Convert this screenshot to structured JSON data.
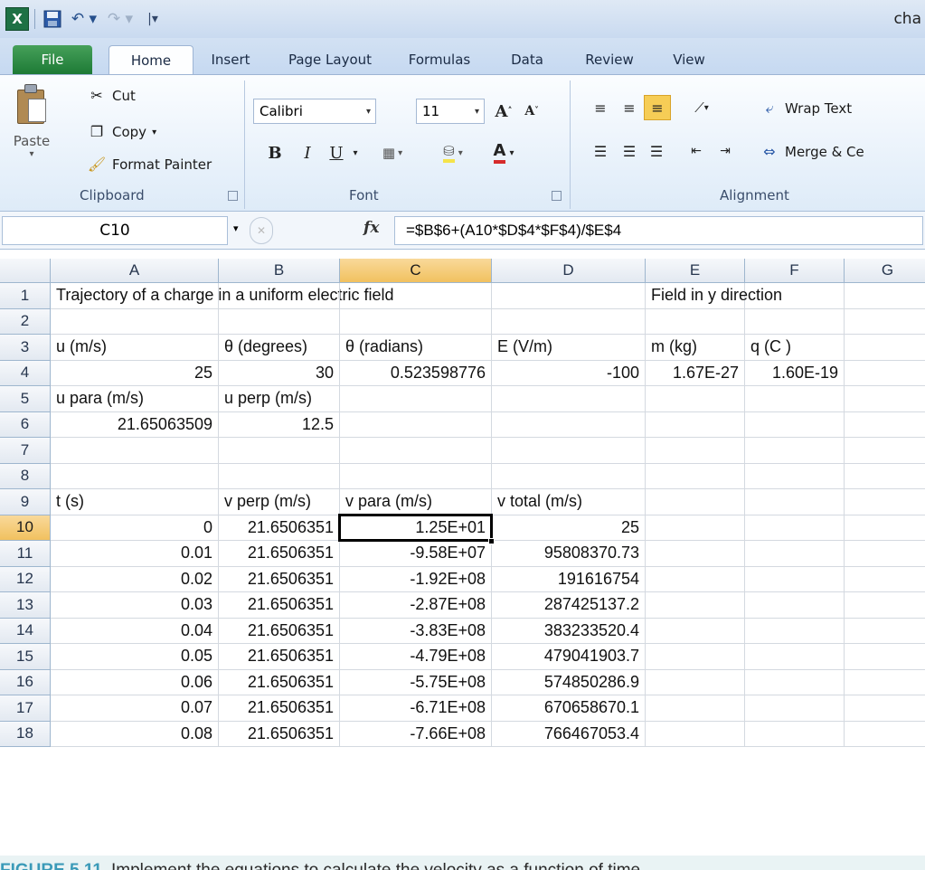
{
  "titlebar": {
    "doc_title": "cha",
    "logo_glyph": "X"
  },
  "tabs": [
    {
      "label": "File"
    },
    {
      "label": "Home"
    },
    {
      "label": "Insert"
    },
    {
      "label": "Page Layout"
    },
    {
      "label": "Formulas"
    },
    {
      "label": "Data"
    },
    {
      "label": "Review"
    },
    {
      "label": "View"
    }
  ],
  "ribbon": {
    "clipboard": {
      "paste": "Paste",
      "cut": "Cut",
      "copy": "Copy",
      "format_painter": "Format Painter",
      "group_label": "Clipboard"
    },
    "font": {
      "font_name": "Calibri",
      "font_size": "11",
      "group_label": "Font",
      "bold": "B",
      "italic": "I",
      "underline": "U"
    },
    "alignment": {
      "wrap_text": "Wrap Text",
      "merge": "Merge & Ce",
      "group_label": "Alignment"
    }
  },
  "formula_bar": {
    "name_box": "C10",
    "fx": "fx",
    "formula": "=$B$6+(A10*$D$4*$F$4)/$E$4"
  },
  "grid": {
    "columns": [
      "A",
      "B",
      "C",
      "D",
      "E",
      "F",
      "G"
    ],
    "active_column": "C",
    "active_row": "10",
    "rows": [
      {
        "n": "1",
        "cells": [
          "Trajectory of a charge in a uniform electric field",
          "",
          "",
          "",
          "Field in y direction",
          "",
          ""
        ]
      },
      {
        "n": "2",
        "cells": [
          "",
          "",
          "",
          "",
          "",
          "",
          ""
        ]
      },
      {
        "n": "3",
        "cells": [
          "u (m/s)",
          "θ (degrees)",
          "θ (radians)",
          "E (V/m)",
          "m (kg)",
          "q (C )",
          ""
        ]
      },
      {
        "n": "4",
        "cells": [
          "25",
          "30",
          "0.523598776",
          "-100",
          "1.67E-27",
          "1.60E-19",
          ""
        ]
      },
      {
        "n": "5",
        "cells": [
          "u para  (m/s)",
          "u perp  (m/s)",
          "",
          "",
          "",
          "",
          ""
        ]
      },
      {
        "n": "6",
        "cells": [
          "21.65063509",
          "12.5",
          "",
          "",
          "",
          "",
          ""
        ]
      },
      {
        "n": "7",
        "cells": [
          "",
          "",
          "",
          "",
          "",
          "",
          ""
        ]
      },
      {
        "n": "8",
        "cells": [
          "",
          "",
          "",
          "",
          "",
          "",
          ""
        ]
      },
      {
        "n": "9",
        "cells": [
          "t (s)",
          "v perp (m/s)",
          "v para (m/s)",
          "v total (m/s)",
          "",
          "",
          ""
        ]
      },
      {
        "n": "10",
        "cells": [
          "0",
          "21.6506351",
          "1.25E+01",
          "25",
          "",
          "",
          ""
        ]
      },
      {
        "n": "11",
        "cells": [
          "0.01",
          "21.6506351",
          "-9.58E+07",
          "95808370.73",
          "",
          "",
          ""
        ]
      },
      {
        "n": "12",
        "cells": [
          "0.02",
          "21.6506351",
          "-1.92E+08",
          "191616754",
          "",
          "",
          ""
        ]
      },
      {
        "n": "13",
        "cells": [
          "0.03",
          "21.6506351",
          "-2.87E+08",
          "287425137.2",
          "",
          "",
          ""
        ]
      },
      {
        "n": "14",
        "cells": [
          "0.04",
          "21.6506351",
          "-3.83E+08",
          "383233520.4",
          "",
          "",
          ""
        ]
      },
      {
        "n": "15",
        "cells": [
          "0.05",
          "21.6506351",
          "-4.79E+08",
          "479041903.7",
          "",
          "",
          ""
        ]
      },
      {
        "n": "16",
        "cells": [
          "0.06",
          "21.6506351",
          "-5.75E+08",
          "574850286.9",
          "",
          "",
          ""
        ]
      },
      {
        "n": "17",
        "cells": [
          "0.07",
          "21.6506351",
          "-6.71E+08",
          "670658670.1",
          "",
          "",
          ""
        ]
      },
      {
        "n": "18",
        "cells": [
          "0.08",
          "21.6506351",
          "-7.66E+08",
          "766467053.4",
          "",
          "",
          ""
        ]
      }
    ]
  },
  "caption": {
    "label": "FIGURE 5.11",
    "text": "Implement the equations to calculate the velocity as a function of time."
  }
}
